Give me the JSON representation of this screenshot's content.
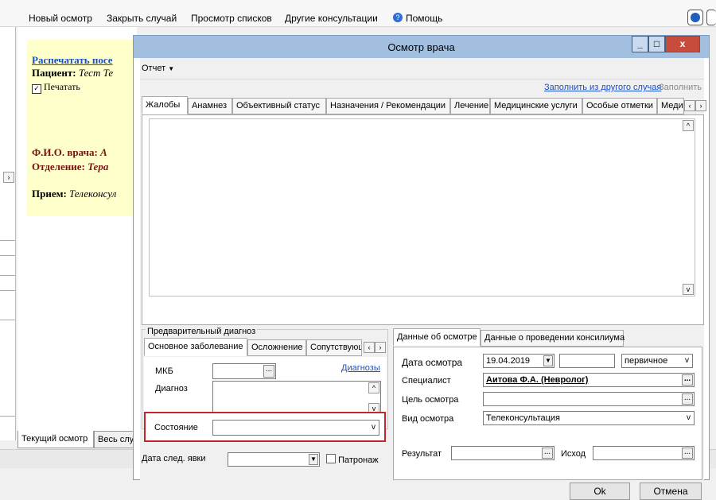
{
  "top_menu": {
    "items": [
      "Новый осмотр",
      "Закрыть случай",
      "Просмотр списков",
      "Другие консультации",
      "Помощь"
    ]
  },
  "background_doc": {
    "print_link": "Распечатать посе",
    "patient_label": "Пациент:",
    "patient_value": "Тест Те",
    "print_checkbox_label": "Печатать",
    "print_checked": true,
    "doctor_label": "Ф.И.О. врача:",
    "doctor_value": "А",
    "dept_label": "Отделение:",
    "dept_value": "Тера",
    "reception_label": "Прием:",
    "reception_value": "Телеконсул",
    "tabs": [
      "Текущий осмотр",
      "Весь слу"
    ]
  },
  "dialog": {
    "title": "Осмотр врача",
    "minimize": "_",
    "maximize": "□",
    "close": "x",
    "report_menu": "Отчет",
    "fill_from_other_link": "Заполнить из другого случая",
    "fill_label": "Заполнить",
    "tabs": [
      "Жалобы",
      "Анамнез",
      "Объективный статус",
      "Назначения / Рекомендации",
      "Лечение",
      "Медицинские услуги",
      "Особые отметки",
      "Меди"
    ],
    "prelim": {
      "group_label": "Предварительный диагноз",
      "tabs": [
        "Основное заболевание",
        "Осложнение",
        "Сопутствующ"
      ],
      "mkb_label": "МКБ",
      "diagnoses_link": "Диагнозы",
      "diagnosis_label": "Диагноз",
      "state_label": "Состояние",
      "state_value": ""
    },
    "next_visit_label": "Дата след. явки",
    "patronage_label": "Патронаж",
    "patronage_checked": false,
    "exam": {
      "tabs": [
        "Данные об осмотре",
        "Данные о проведении консилиума"
      ],
      "date_label": "Дата осмотра",
      "date_value": "19.04.2019",
      "type_value": "первичное",
      "specialist_label": "Специалист",
      "specialist_value": "Аитова Ф.А. (Невролог)",
      "purpose_label": "Цель осмотра",
      "kind_label": "Вид осмотра",
      "kind_value": "Телеконсультация",
      "result_label": "Результат",
      "outcome_label": "Исход"
    },
    "ok_label": "Ok",
    "cancel_label": "Отмена"
  },
  "colors": {
    "highlight_border": "#c0282d",
    "link": "#1a4fcc",
    "background_yellow": "#ffffcc"
  }
}
